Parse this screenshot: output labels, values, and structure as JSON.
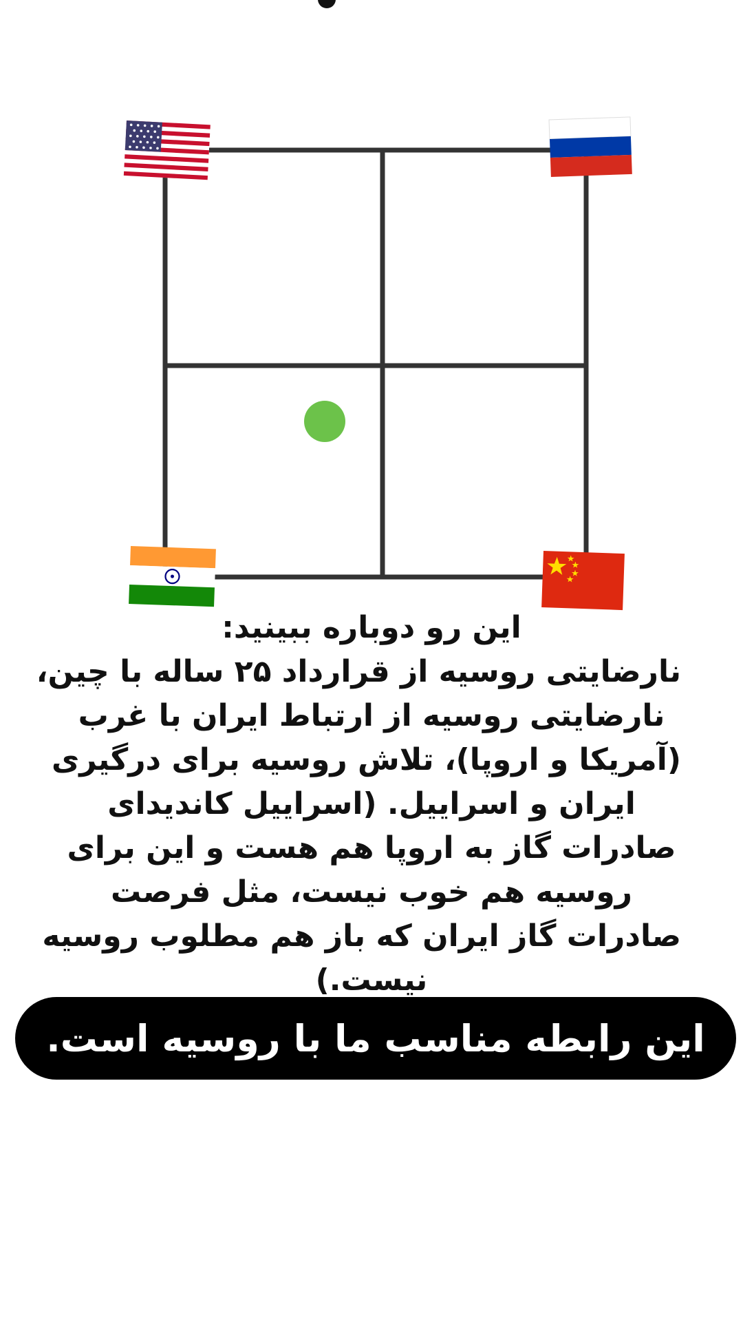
{
  "caption": {
    "lines": [
      "این رو دوباره ببینید:",
      "نارضایتی روسیه از قرارداد ۲۵ ساله با چین،",
      "نارضایتی روسیه از ارتباط ایران با غرب",
      "(آمریکا و اروپا)، تلاش روسیه برای درگیری",
      "ایران و اسراییل. (اسراییل کاندیدای",
      "صادرات گاز به اروپا هم هست و این برای",
      "روسیه هم خوب نیست، مثل فرصت",
      "صادرات گاز ایران که باز هم مطلوب روسیه",
      "نیست.)"
    ]
  },
  "banner": {
    "text": "این رابطه مناسب ما با روسیه است."
  },
  "diagram": {
    "flags": [
      "usa-flag-icon",
      "russia-flag-icon",
      "india-flag-icon",
      "china-flag-icon"
    ],
    "dot_color": "#6cc24a",
    "grid_color": "#333333"
  }
}
